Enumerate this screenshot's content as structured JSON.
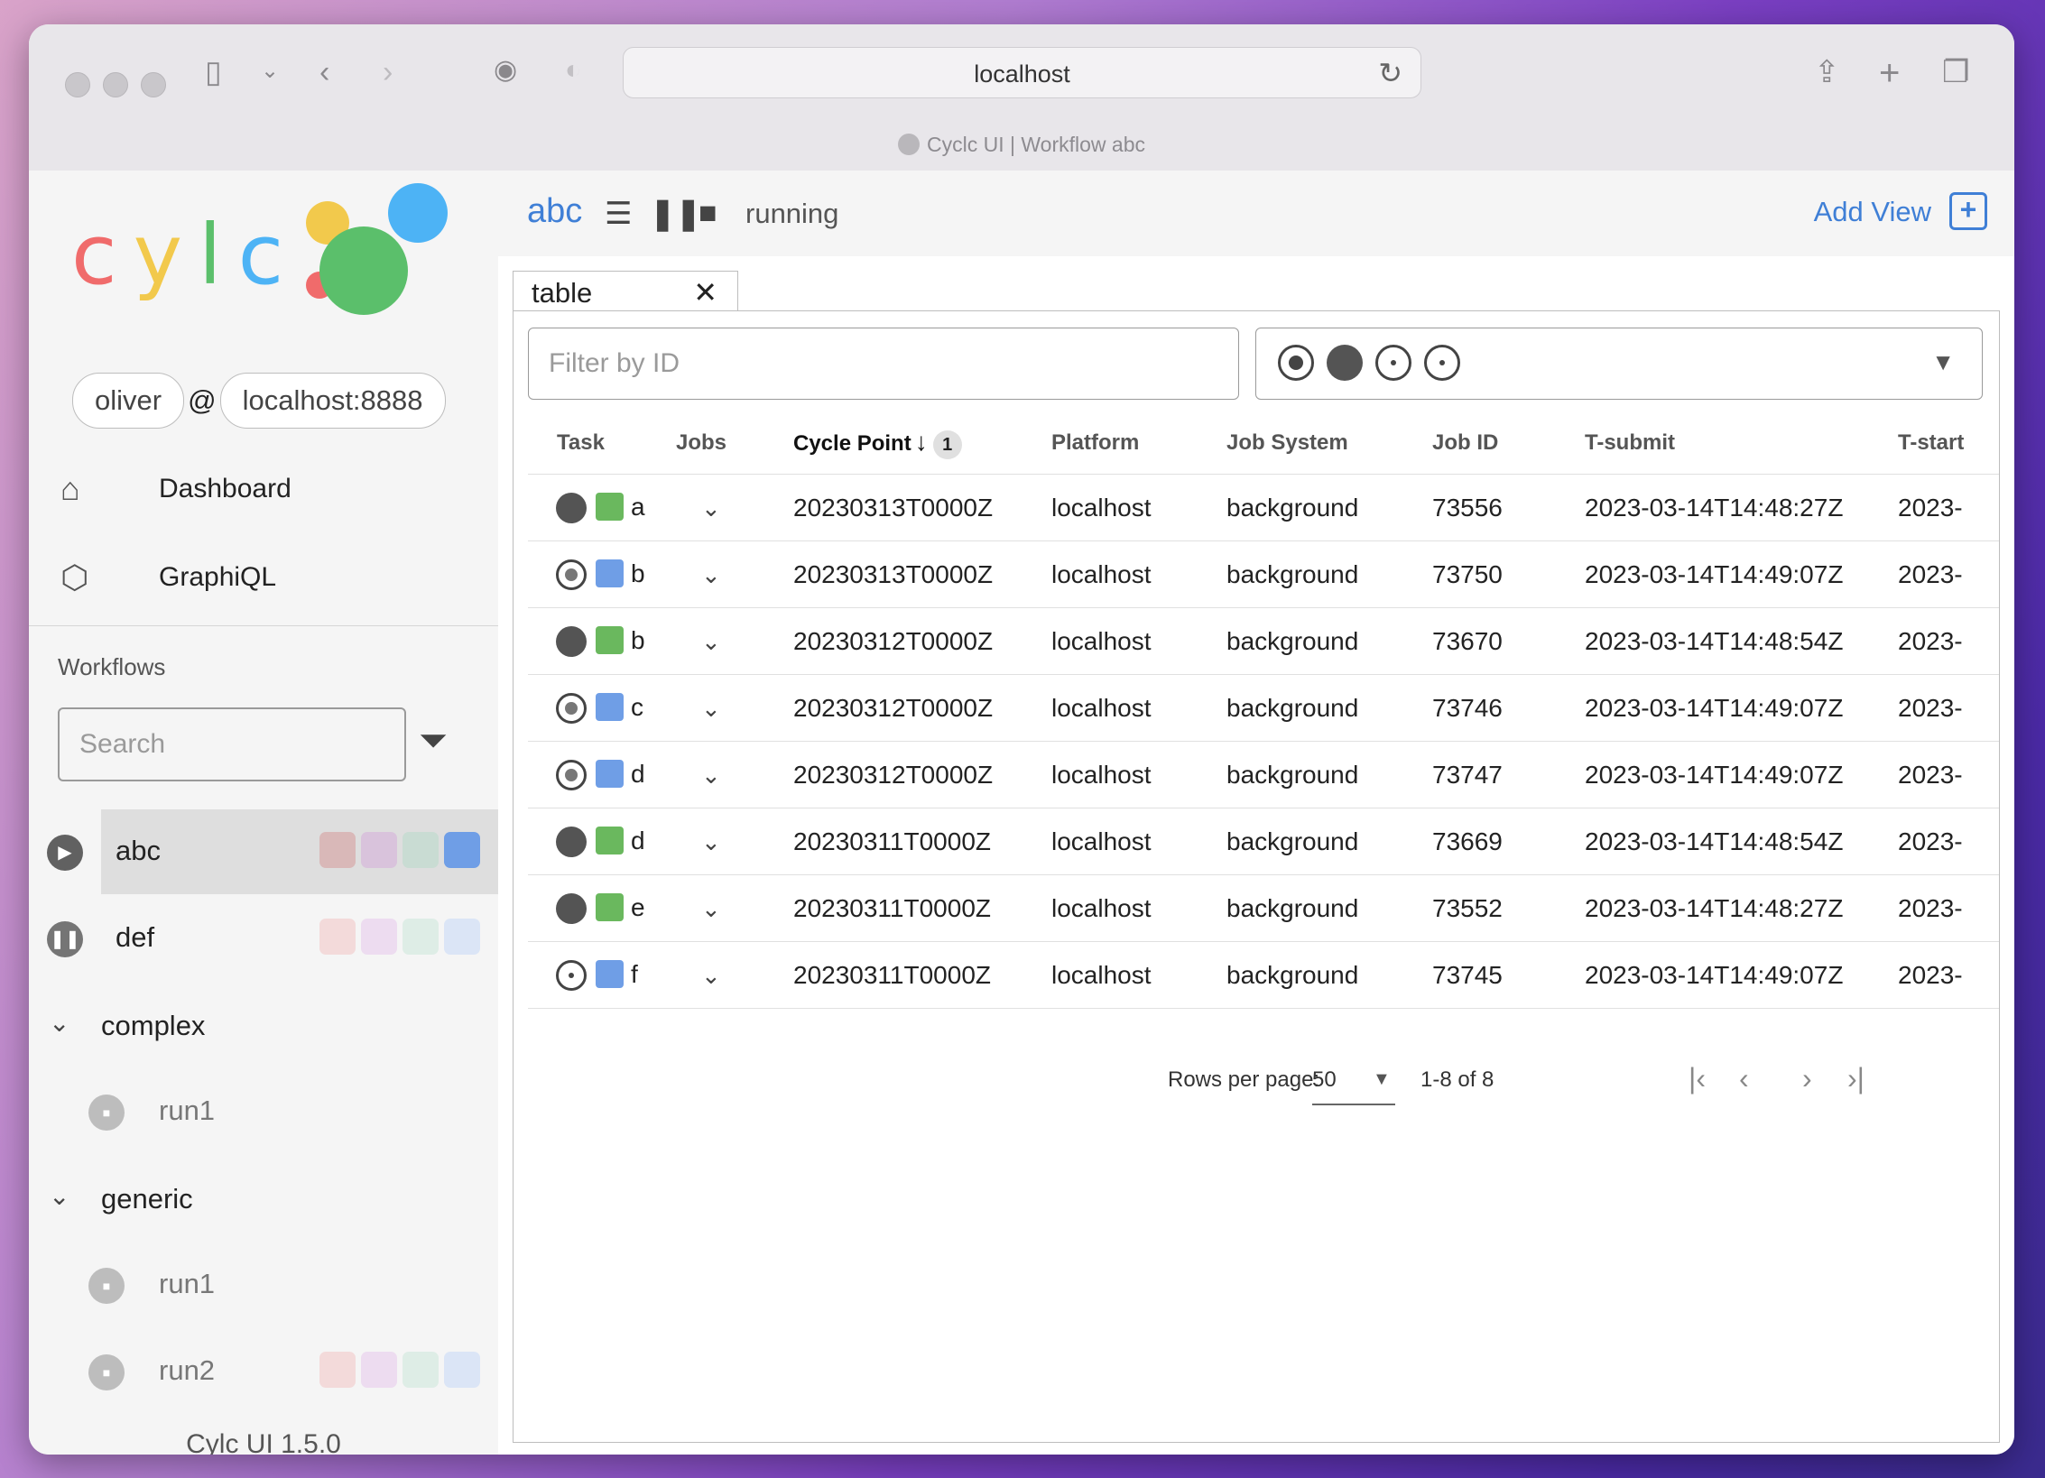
{
  "browser": {
    "url": "localhost",
    "tab_title": "Cyclc UI | Workflow abc"
  },
  "sidebar": {
    "logo_text": "cylc",
    "user": "oliver",
    "at": "@",
    "host": "localhost:8888",
    "nav": [
      {
        "label": "Dashboard",
        "icon": "home-icon"
      },
      {
        "label": "GraphiQL",
        "icon": "graphql-icon"
      }
    ],
    "workflows_title": "Workflows",
    "search_placeholder": "Search",
    "workflows": [
      {
        "name": "abc",
        "status": "running",
        "selected": true
      },
      {
        "name": "def",
        "status": "paused",
        "selected": false
      }
    ],
    "groups": [
      {
        "name": "complex",
        "runs": [
          {
            "name": "run1",
            "status": "stopped"
          }
        ]
      },
      {
        "name": "generic",
        "runs": [
          {
            "name": "run1",
            "status": "stopped"
          },
          {
            "name": "run2",
            "status": "stopped"
          }
        ]
      }
    ],
    "version": "Cylc UI 1.5.0"
  },
  "main": {
    "workflow_name": "abc",
    "workflow_status": "running",
    "add_view_label": "Add View",
    "tab_label": "table",
    "filter_placeholder": "Filter by ID",
    "columns": [
      "Task",
      "Jobs",
      "Cycle Point",
      "Platform",
      "Job System",
      "Job ID",
      "T-submit",
      "T-start"
    ],
    "sort_badge": "1",
    "rows": [
      {
        "state": "running",
        "job": "succeeded",
        "task": "a",
        "cycle": "20230313T0000Z",
        "platform": "localhost",
        "system": "background",
        "job_id": "73556",
        "t_submit": "2023-03-14T14:48:27Z",
        "t_start": "2023-"
      },
      {
        "state": "submitted",
        "job": "submitted",
        "task": "b",
        "cycle": "20230313T0000Z",
        "platform": "localhost",
        "system": "background",
        "job_id": "73750",
        "t_submit": "2023-03-14T14:49:07Z",
        "t_start": "2023-"
      },
      {
        "state": "running",
        "job": "succeeded",
        "task": "b",
        "cycle": "20230312T0000Z",
        "platform": "localhost",
        "system": "background",
        "job_id": "73670",
        "t_submit": "2023-03-14T14:48:54Z",
        "t_start": "2023-"
      },
      {
        "state": "submitted",
        "job": "submitted",
        "task": "c",
        "cycle": "20230312T0000Z",
        "platform": "localhost",
        "system": "background",
        "job_id": "73746",
        "t_submit": "2023-03-14T14:49:07Z",
        "t_start": "2023-"
      },
      {
        "state": "submitted",
        "job": "submitted",
        "task": "d",
        "cycle": "20230312T0000Z",
        "platform": "localhost",
        "system": "background",
        "job_id": "73747",
        "t_submit": "2023-03-14T14:49:07Z",
        "t_start": "2023-"
      },
      {
        "state": "running",
        "job": "succeeded",
        "task": "d",
        "cycle": "20230311T0000Z",
        "platform": "localhost",
        "system": "background",
        "job_id": "73669",
        "t_submit": "2023-03-14T14:48:54Z",
        "t_start": "2023-"
      },
      {
        "state": "running",
        "job": "succeeded",
        "task": "e",
        "cycle": "20230311T0000Z",
        "platform": "localhost",
        "system": "background",
        "job_id": "73552",
        "t_submit": "2023-03-14T14:48:27Z",
        "t_start": "2023-"
      },
      {
        "state": "waiting",
        "job": "submitted",
        "task": "f",
        "cycle": "20230311T0000Z",
        "platform": "localhost",
        "system": "background",
        "job_id": "73745",
        "t_submit": "2023-03-14T14:49:07Z",
        "t_start": "2023-"
      }
    ],
    "rows_per_page_label": "Rows per page:",
    "rows_per_page": "50",
    "range": "1-8 of 8"
  },
  "colors": {
    "accent": "#3f7fd6",
    "job_succeeded": "#6ab85e",
    "job_submitted": "#6f9ee6",
    "task_running": "#545454"
  }
}
